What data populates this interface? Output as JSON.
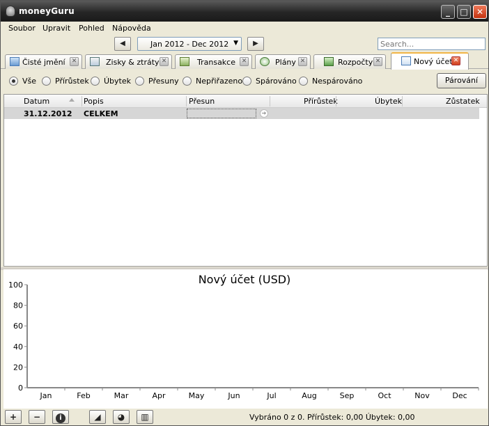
{
  "window": {
    "title": "moneyGuru"
  },
  "menu": [
    "Soubor",
    "Upravit",
    "Pohled",
    "Nápověda"
  ],
  "date_range": {
    "value": "Jan 2012 - Dec 2012"
  },
  "search": {
    "placeholder": "Search..."
  },
  "tabs": [
    {
      "label": "Čisté jmění",
      "icon": "net-worth-icon"
    },
    {
      "label": "Zisky & ztráty",
      "icon": "profit-loss-icon"
    },
    {
      "label": "Transakce",
      "icon": "transactions-icon"
    },
    {
      "label": "Plány",
      "icon": "schedules-icon"
    },
    {
      "label": "Rozpočty",
      "icon": "budgets-icon"
    },
    {
      "label": "Nový účet",
      "icon": "account-icon",
      "active": true
    }
  ],
  "filters": [
    {
      "label": "Vše",
      "selected": true
    },
    {
      "label": "Přírůstek",
      "selected": false
    },
    {
      "label": "Úbytek",
      "selected": false
    },
    {
      "label": "Přesuny",
      "selected": false
    },
    {
      "label": "Nepřiřazeno",
      "selected": false
    },
    {
      "label": "Spárováno",
      "selected": false
    },
    {
      "label": "Nespárováno",
      "selected": false
    }
  ],
  "reconcile_button": "Párování",
  "table": {
    "columns": [
      "Datum",
      "Popis",
      "Přesun",
      "Přírůstek",
      "Úbytek",
      "Zůstatek"
    ],
    "rows": [
      {
        "date": "31.12.2012",
        "description": "CELKEM",
        "transfer": "",
        "increase": "",
        "decrease": "",
        "balance": ""
      }
    ]
  },
  "chart_data": {
    "type": "bar",
    "title": "Nový účet (USD)",
    "categories": [
      "Jan",
      "Feb",
      "Mar",
      "Apr",
      "May",
      "Jun",
      "Jul",
      "Aug",
      "Sep",
      "Oct",
      "Nov",
      "Dec"
    ],
    "values": [],
    "ylim": [
      0,
      100
    ],
    "yticks": [
      0,
      20,
      40,
      60,
      80,
      100
    ]
  },
  "bottom": {
    "add": "+",
    "remove": "−",
    "info": "i",
    "status": "Vybráno 0 z 0. Přírůstek: 0,00 Úbytek: 0,00"
  }
}
